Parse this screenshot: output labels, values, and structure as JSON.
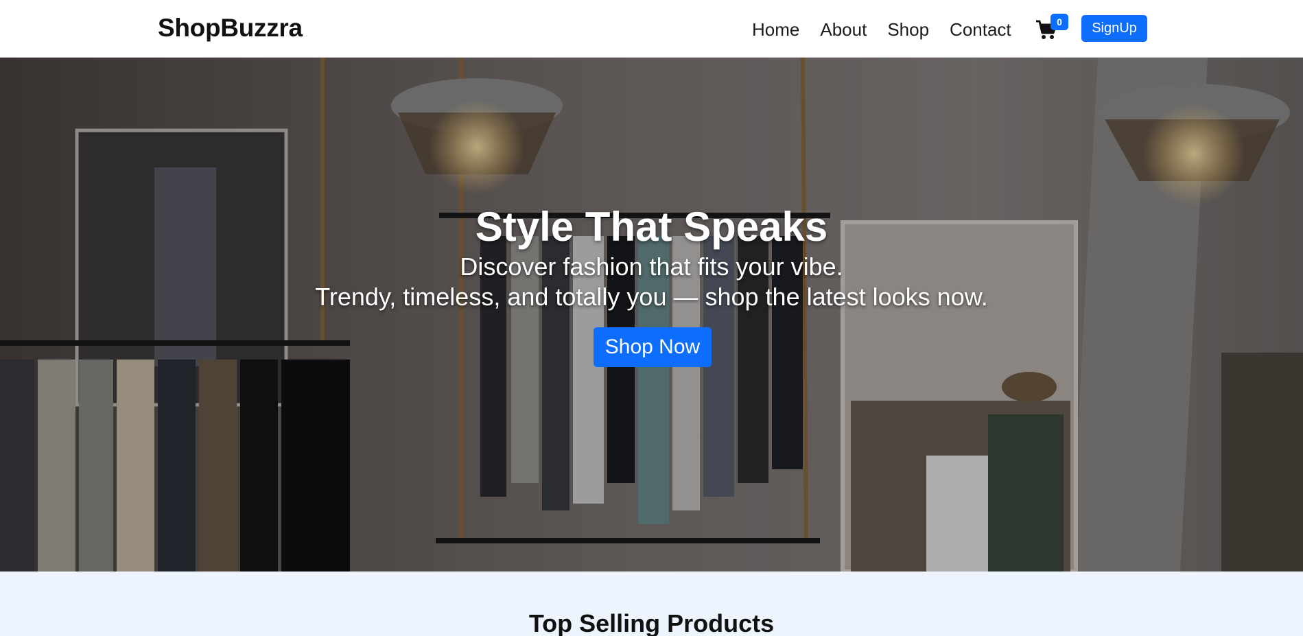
{
  "navbar": {
    "brand": "ShopBuzzra",
    "links": [
      "Home",
      "About",
      "Shop",
      "Contact"
    ],
    "cart_count": "0",
    "cart_icon": "cart-icon",
    "signup_label": "SignUp"
  },
  "hero": {
    "title": "Style That Speaks",
    "subtitle_line1": "Discover fashion that fits your vibe.",
    "subtitle_line2": "Trendy, timeless, and totally you — shop the latest looks now.",
    "cta_label": "Shop Now"
  },
  "top_selling": {
    "title": "Top Selling Products"
  },
  "colors": {
    "primary": "#0d6efd",
    "section_bg": "#eef4fe",
    "text_dark": "#111111"
  }
}
